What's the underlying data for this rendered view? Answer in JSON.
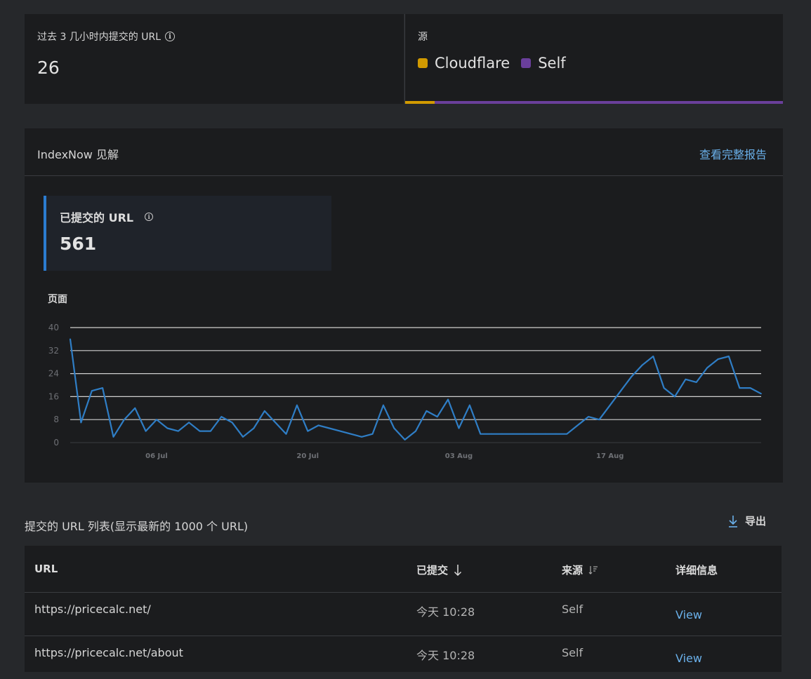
{
  "stats": {
    "recent_label": "过去 3 几小时内提交的 URL",
    "recent_value": "26",
    "source_label": "源",
    "sources": [
      {
        "name": "Cloudflare",
        "color": "#d19a00",
        "share": 0.078
      },
      {
        "name": "Self",
        "color": "#6a3f9b",
        "share": 0.922
      }
    ]
  },
  "insights": {
    "title": "IndexNow 见解",
    "full_report_link": "查看完整报告",
    "kpi_label": "已提交的 URL",
    "kpi_value": "561"
  },
  "chart_data": {
    "type": "line",
    "ylabel": "页面",
    "ylim": [
      0,
      40
    ],
    "yticks": [
      0,
      8,
      16,
      24,
      32,
      40
    ],
    "xticks": [
      {
        "label": "06 Jul",
        "day": 8
      },
      {
        "label": "20 Jul",
        "day": 22
      },
      {
        "label": "03 Aug",
        "day": 36
      },
      {
        "label": "17 Aug",
        "day": 50
      }
    ],
    "line_color": "#2f7ec6",
    "series": [
      {
        "values": [
          36,
          7,
          18,
          19,
          2,
          8,
          12,
          4,
          8,
          5,
          4,
          7,
          4,
          4,
          9,
          7,
          2,
          5,
          11,
          7,
          3,
          13,
          4,
          6,
          5,
          4,
          3,
          2,
          3,
          13,
          5,
          1,
          4,
          11,
          9,
          15,
          5,
          13,
          3,
          3,
          3,
          3,
          3,
          3,
          3,
          3,
          3,
          6,
          9,
          8,
          13,
          18,
          23,
          27,
          30,
          19,
          16,
          22,
          21,
          26,
          29,
          30,
          19,
          19,
          17
        ]
      }
    ]
  },
  "url_list": {
    "title": "提交的 URL 列表(显示最新的 1000 个 URL)",
    "export_label": "导出",
    "columns": {
      "url": "URL",
      "submitted": "已提交",
      "source": "来源",
      "details": "详细信息"
    },
    "rows": [
      {
        "url": "https://pricecalc.net/",
        "submitted": "今天 10:28",
        "source": "Self",
        "details": "View"
      },
      {
        "url": "https://pricecalc.net/about",
        "submitted": "今天 10:28",
        "source": "Self",
        "details": "View"
      }
    ]
  }
}
